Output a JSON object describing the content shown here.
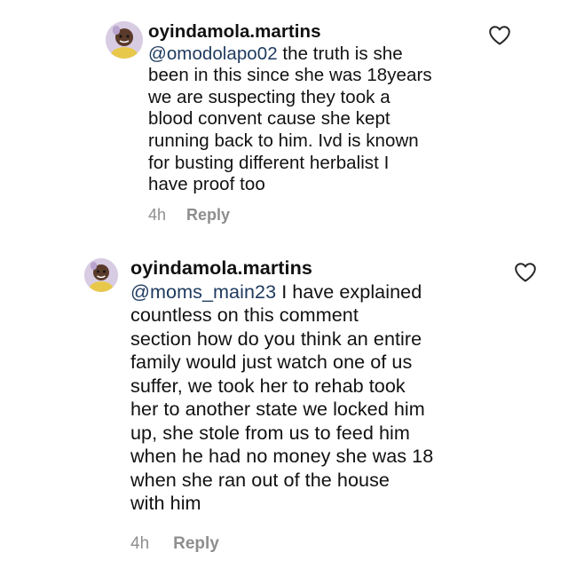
{
  "comments": [
    {
      "username": "oyindamola.martins",
      "mention": "@omodolapo02",
      "lines_first": " the truth is she",
      "lines": [
        "been in this since she was 18years",
        "we are suspecting they took a",
        "blood convent cause she kept",
        "running back to him. Ivd is known",
        "for busting different herbalist I",
        "have proof too"
      ],
      "time": "4h",
      "reply_label": "Reply"
    },
    {
      "username": "oyindamola.martins",
      "mention": "@moms_main23",
      "lines_first": " I have explained",
      "lines": [
        "countless on this comment",
        "section how do you think an entire",
        "family would just watch one of us",
        "suffer, we took her to rehab took",
        "her to another state we locked him",
        "up, she stole from us to feed him",
        "when he had no money she was 18",
        "when she ran out of the house",
        "with him"
      ],
      "time": "4h",
      "reply_label": "Reply"
    }
  ],
  "colors": {
    "mention": "#1e3a5f",
    "meta": "#8e8e8e",
    "text": "#111111"
  },
  "icons": {
    "like": "heart-outline-icon",
    "avatar": "profile-photo"
  }
}
